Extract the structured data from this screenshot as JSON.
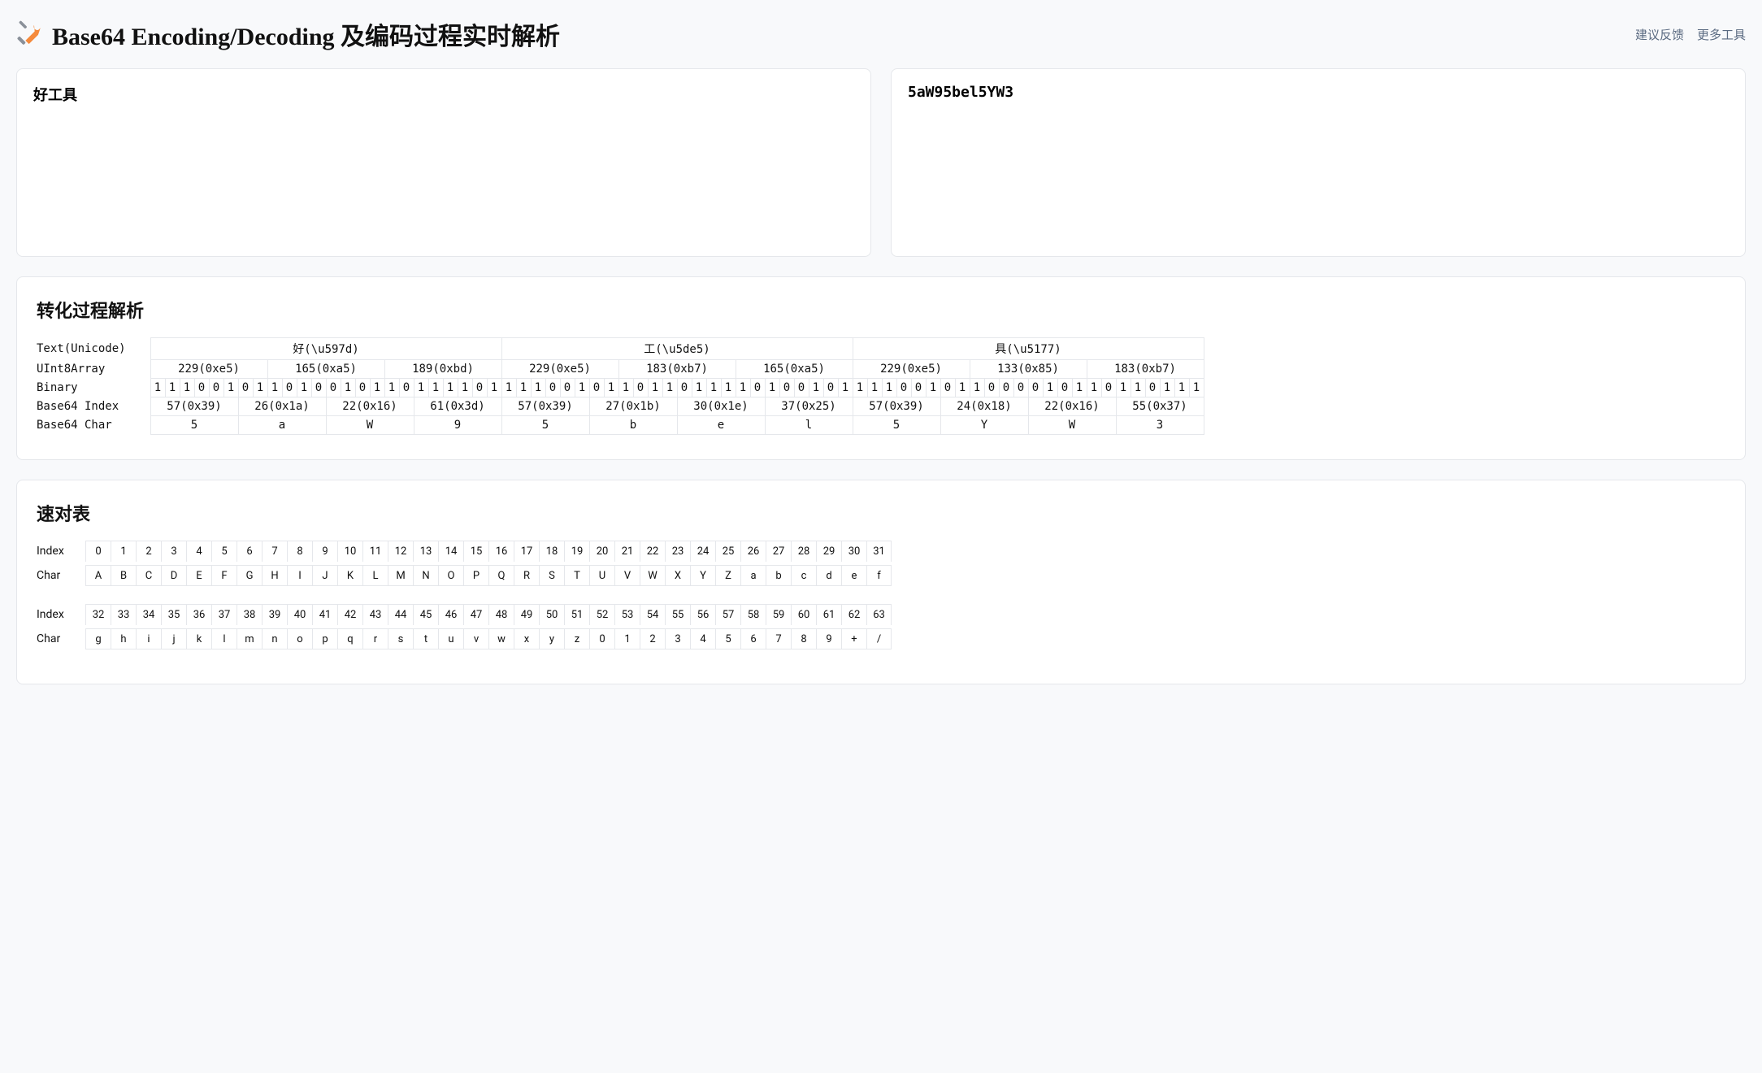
{
  "header": {
    "title": "Base64 Encoding/Decoding 及编码过程实时解析",
    "links": {
      "feedback": "建议反馈",
      "more": "更多工具"
    }
  },
  "io": {
    "input_value": "好工具",
    "output_value": "5aW95bel5YW3"
  },
  "analysis": {
    "title": "转化过程解析",
    "row_labels": {
      "text": "Text(Unicode)",
      "uint8": "UInt8Array",
      "binary": "Binary",
      "b64index": "Base64 Index",
      "b64char": "Base64 Char"
    },
    "chars": [
      {
        "display": "好(\\u597d)",
        "bytes": [
          "229(0xe5)",
          "165(0xa5)",
          "189(0xbd)"
        ]
      },
      {
        "display": "工(\\u5de5)",
        "bytes": [
          "229(0xe5)",
          "183(0xb7)",
          "165(0xa5)"
        ]
      },
      {
        "display": "具(\\u5177)",
        "bytes": [
          "229(0xe5)",
          "133(0x85)",
          "183(0xb7)"
        ]
      }
    ],
    "bits": "111001011010010110111101111001011011011110100101111001011000010110110111",
    "b64_groups": [
      {
        "idx": "57(0x39)",
        "ch": "5"
      },
      {
        "idx": "26(0x1a)",
        "ch": "a"
      },
      {
        "idx": "22(0x16)",
        "ch": "W"
      },
      {
        "idx": "61(0x3d)",
        "ch": "9"
      },
      {
        "idx": "57(0x39)",
        "ch": "5"
      },
      {
        "idx": "27(0x1b)",
        "ch": "b"
      },
      {
        "idx": "30(0x1e)",
        "ch": "e"
      },
      {
        "idx": "37(0x25)",
        "ch": "l"
      },
      {
        "idx": "57(0x39)",
        "ch": "5"
      },
      {
        "idx": "24(0x18)",
        "ch": "Y"
      },
      {
        "idx": "22(0x16)",
        "ch": "W"
      },
      {
        "idx": "55(0x37)",
        "ch": "3"
      }
    ]
  },
  "lookup": {
    "title": "速对表",
    "labels": {
      "index": "Index",
      "char": "Char"
    },
    "table": "ABCDEFGHIJKLMNOPQRSTUVWXYZabcdefghijklmnopqrstuvwxyz0123456789+/"
  }
}
